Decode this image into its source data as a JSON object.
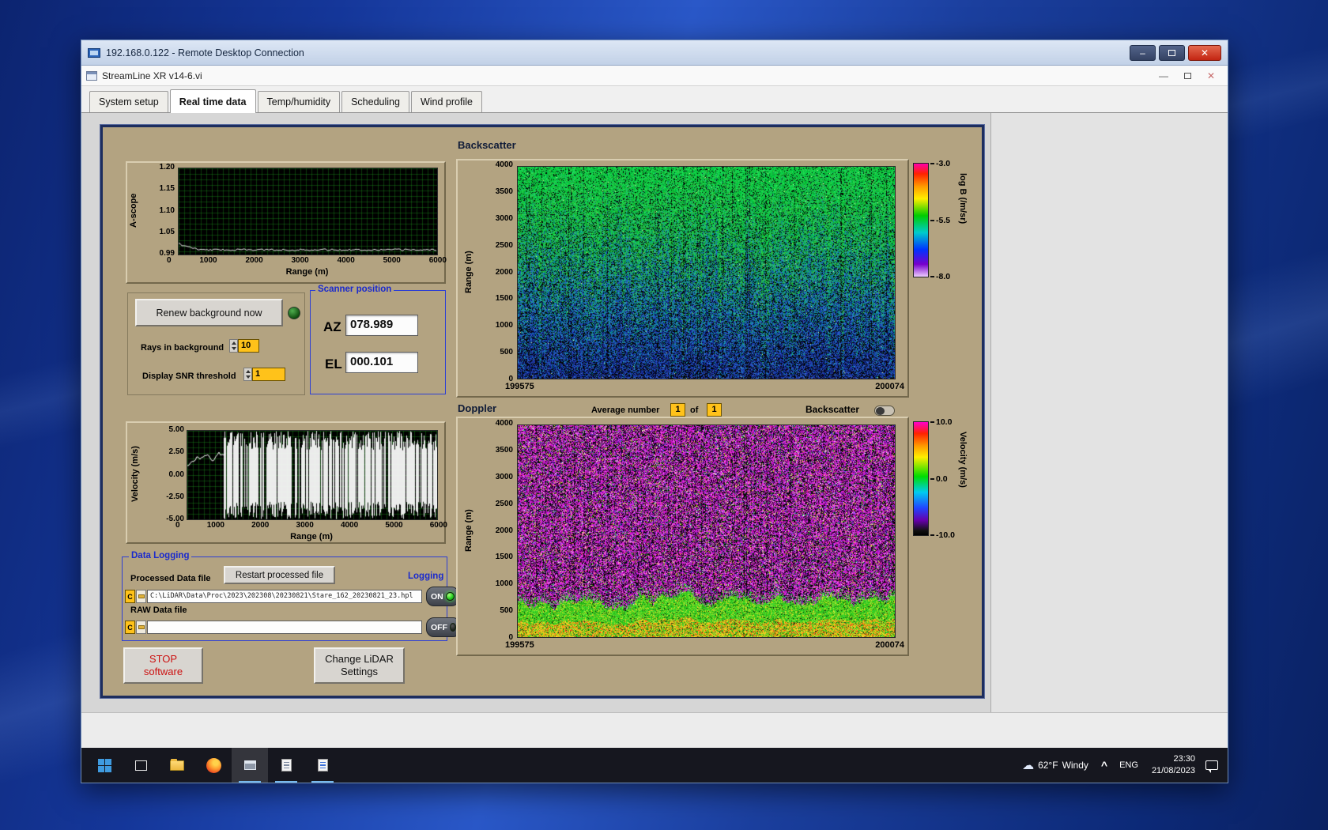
{
  "rdp": {
    "title": "192.168.0.122 - Remote Desktop Connection",
    "minimize_glyph": "–",
    "close_glyph": "✕"
  },
  "app": {
    "title": "StreamLine XR v14-6.vi",
    "minimize_glyph": "—",
    "close_glyph": "✕",
    "tabs": [
      {
        "label": "System setup"
      },
      {
        "label": "Real time data"
      },
      {
        "label": "Temp/humidity"
      },
      {
        "label": "Scheduling"
      },
      {
        "label": "Wind profile"
      }
    ]
  },
  "ascope": {
    "ylabel": "A-scope",
    "xlabel": "Range (m)",
    "yticks": [
      "1.20",
      "1.15",
      "1.10",
      "1.05",
      "0.99"
    ],
    "xticks": [
      "0",
      "1000",
      "2000",
      "3000",
      "4000",
      "5000",
      "6000"
    ]
  },
  "background_controls": {
    "renew_button": "Renew background now",
    "rays_label": "Rays in background",
    "rays_value": "10",
    "snr_label": "Display SNR threshold",
    "snr_value": "1"
  },
  "scanner": {
    "title": "Scanner position",
    "az_label": "AZ",
    "az_value": "078.989",
    "el_label": "EL",
    "el_value": "000.101"
  },
  "velocity_plot": {
    "ylabel": "Velocity (m/s)",
    "xlabel": "Range (m)",
    "yticks": [
      "5.00",
      "2.50",
      "0.00",
      "-2.50",
      "-5.00"
    ],
    "xticks": [
      "0",
      "1000",
      "2000",
      "3000",
      "4000",
      "5000",
      "6000"
    ]
  },
  "logging": {
    "title": "Data Logging",
    "processed_label": "Processed Data file",
    "restart_button": "Restart processed file",
    "logging_label": "Logging",
    "drive_letter": "C",
    "processed_path": "C:\\LiDAR\\Data\\Proc\\2023\\202308\\20230821\\Stare_162_20230821_23.hpl",
    "raw_label": "RAW Data file",
    "raw_path": "",
    "on_label": "ON",
    "off_label": "OFF"
  },
  "actions": {
    "stop_line1": "STOP",
    "stop_line2": "software",
    "change_line1": "Change LiDAR",
    "change_line2": "Settings"
  },
  "backscatter": {
    "title": "Backscatter",
    "ylabel": "Range (m)",
    "yticks": [
      "4000",
      "3500",
      "3000",
      "2500",
      "2000",
      "1500",
      "1000",
      "500",
      "0"
    ],
    "x_start": "199575",
    "x_end": "200074",
    "colorbar_label": "log B (/m/sr)",
    "colorbar_ticks": [
      "-3.0",
      "-5.5",
      "-8.0"
    ]
  },
  "doppler": {
    "title": "Doppler",
    "avg_label": "Average number",
    "avg_value": "1",
    "of_label": "of",
    "avg_total": "1",
    "toggle_label": "Backscatter",
    "ylabel": "Range (m)",
    "yticks": [
      "4000",
      "3500",
      "3000",
      "2500",
      "2000",
      "1500",
      "1000",
      "500",
      "0"
    ],
    "x_start": "199575",
    "x_end": "200074",
    "colorbar_label": "Velocity (m/s)",
    "colorbar_ticks": [
      "10.0",
      "0.0",
      "-10.0"
    ]
  },
  "taskbar": {
    "weather_temp": "62°F",
    "weather_desc": "Windy",
    "chevron": "^",
    "language": "ENG",
    "time": "23:30",
    "date": "21/08/2023"
  }
}
